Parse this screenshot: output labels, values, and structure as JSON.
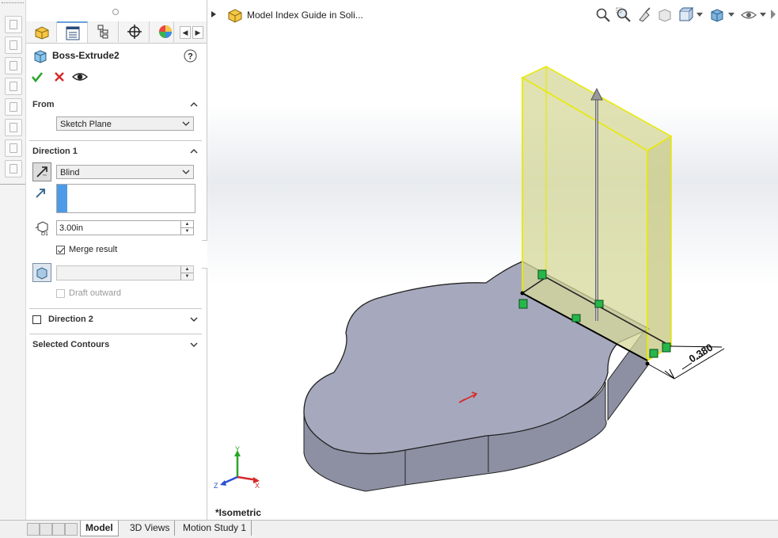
{
  "property_manager": {
    "feature_title": "Boss-Extrude2",
    "from": {
      "header": "From",
      "start_condition": "Sketch Plane"
    },
    "direction1": {
      "header": "Direction 1",
      "end_condition": "Blind",
      "depth": "3.00in",
      "merge_result_label": "Merge result",
      "merge_result_checked": true,
      "draft_angle": "",
      "draft_outward_label": "Draft outward",
      "draft_outward_checked": false
    },
    "direction2": {
      "header": "Direction 2",
      "checked": false
    },
    "selected_contours": {
      "header": "Selected Contours"
    }
  },
  "graphics": {
    "tree_title": "Model Index Guide in Soli...",
    "view_name": "*Isometric",
    "dimension_label": "0.380",
    "triad_labels": {
      "y": "Y",
      "x": "X",
      "z": "Z"
    }
  },
  "bottom_tabs": [
    "Model",
    "3D Views",
    "Motion Study 1"
  ],
  "colors": {
    "model_face": "#a6a9bd",
    "model_side": "#8d90a3",
    "preview_fill": "#d6d89a",
    "preview_edge": "#e8ea00",
    "handle_green": "#26b64a",
    "accent_blue": "#4d9be6"
  }
}
